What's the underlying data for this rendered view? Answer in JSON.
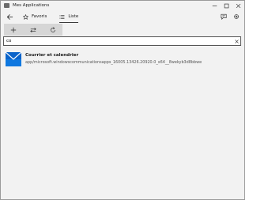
{
  "window": {
    "title": "Mes Applications",
    "title_icon": "app-list-icon"
  },
  "nav": {
    "back_icon": "back-arrow-icon",
    "tabs": [
      {
        "label": "Favoris",
        "icon": "star-icon",
        "active": false
      },
      {
        "label": "Liste",
        "icon": "list-icon",
        "active": true
      }
    ],
    "right_icons": [
      "feedback-icon",
      "gear-icon"
    ]
  },
  "toolbar": {
    "icons": [
      "add-icon",
      "swap-icon",
      "refresh-icon"
    ]
  },
  "search": {
    "value": "co",
    "clear_icon": "close-icon"
  },
  "results": [
    {
      "name": "Courrier et calendrier",
      "id": "app/microsoft.windowscommunicationsapps_16005.13426.20920.0_x64__8wekyb3d8bbwe",
      "icon": "mail-icon"
    }
  ],
  "colors": {
    "accent": "#0078d4",
    "toolbar_bg": "#d6d6d6",
    "window_bg": "#f2f2f2"
  }
}
